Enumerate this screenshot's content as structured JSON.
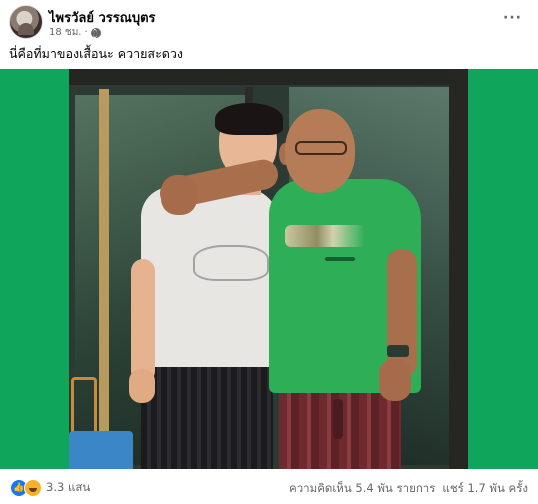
{
  "post": {
    "author": "ไพรวัลย์ วรรณบุตร",
    "time": "18 ชม.",
    "dot": "·",
    "more": "···",
    "caption": "นี่คือที่มาของเสื้อนะ ควายสะดวง"
  },
  "footer": {
    "reactions_count": "3.3 แสน",
    "comments": "ความคิดเห็น 5.4 พัน รายการ",
    "shares": "แชร์ 1.7 พัน ครั้ง",
    "like_glyph": "👍"
  },
  "colors": {
    "background_green": "#0fa55a",
    "like_blue": "#1877f2",
    "meta_gray": "#65676b"
  }
}
